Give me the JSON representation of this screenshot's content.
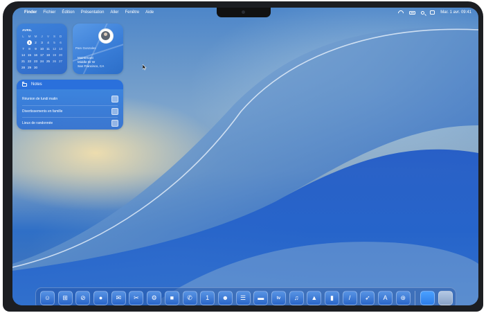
{
  "menubar": {
    "app_name": "Finder",
    "menus": [
      "Fichier",
      "Édition",
      "Présentation",
      "Aller",
      "Fenêtre",
      "Aide"
    ],
    "clock": "Mar. 1 avr.  09:41"
  },
  "calendar": {
    "month": "AVRIL",
    "weekdays": [
      "L",
      "M",
      "M",
      "J",
      "V",
      "S",
      "D"
    ],
    "days": [
      "",
      "1",
      "2",
      "3",
      "4",
      "5",
      "6",
      "7",
      "8",
      "9",
      "10",
      "11",
      "12",
      "13",
      "14",
      "15",
      "16",
      "17",
      "18",
      "19",
      "20",
      "21",
      "22",
      "23",
      "24",
      "25",
      "26",
      "27",
      "28",
      "29",
      "30",
      "",
      "",
      "",
      ""
    ],
    "today": "1"
  },
  "find_my": {
    "person": "Parv Gonzales",
    "status": "Maintenant",
    "street": "Middle Dr W",
    "city": "San Francisco, CA"
  },
  "notes": {
    "title": "Notes",
    "items": [
      "Réunion de lundi matin",
      "Divertissements en famille",
      "Lieux de randonnée"
    ]
  },
  "dock": {
    "apps": [
      {
        "icon": "finder-icon",
        "glyph": "☺"
      },
      {
        "icon": "launchpad-icon",
        "glyph": "⊞"
      },
      {
        "icon": "safari-icon",
        "glyph": "⊘"
      },
      {
        "icon": "messages-icon",
        "glyph": "●"
      },
      {
        "icon": "mail-icon",
        "glyph": "✉"
      },
      {
        "icon": "pinwheel-icon",
        "glyph": "✂"
      },
      {
        "icon": "settings-icon",
        "glyph": "⚙"
      },
      {
        "icon": "facetime-icon",
        "glyph": "■"
      },
      {
        "icon": "phone-icon",
        "glyph": "✆"
      },
      {
        "icon": "calendar-icon",
        "glyph": "1"
      },
      {
        "icon": "contacts-icon",
        "glyph": "☻"
      },
      {
        "icon": "reminders-icon",
        "glyph": "☰"
      },
      {
        "icon": "notes-icon",
        "glyph": "▬"
      },
      {
        "icon": "tv-icon",
        "glyph": "tv"
      },
      {
        "icon": "music-icon",
        "glyph": "♫"
      },
      {
        "icon": "keynote-icon",
        "glyph": "▲"
      },
      {
        "icon": "numbers-icon",
        "glyph": "▮"
      },
      {
        "icon": "pages-icon",
        "glyph": "/"
      },
      {
        "icon": "rocket-icon",
        "glyph": "➶"
      },
      {
        "icon": "app-store-icon",
        "glyph": "A"
      },
      {
        "icon": "system-icon",
        "glyph": "⊛"
      }
    ],
    "folder_icon": "folder-icon",
    "trash_icon": "trash-icon"
  }
}
